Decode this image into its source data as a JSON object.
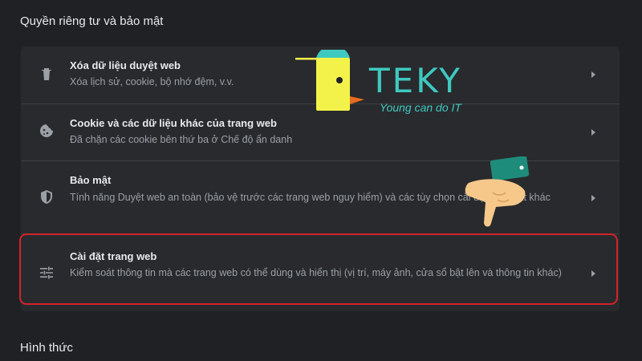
{
  "sections": {
    "privacy_title": "Quyền riêng tư và bảo mật",
    "appearance_title": "Hình thức"
  },
  "rows": [
    {
      "title": "Xóa dữ liệu duyệt web",
      "desc": "Xóa lịch sử, cookie, bộ nhớ đệm, v.v.",
      "icon": "trash-icon"
    },
    {
      "title": "Cookie và các dữ liệu khác của trang web",
      "desc": "Đã chặn các cookie bên thứ ba ở Chế độ ẩn danh",
      "icon": "cookie-icon"
    },
    {
      "title": "Bảo mật",
      "desc": "Tính năng Duyệt web an toàn (bảo vệ trước các trang web nguy hiểm) và các tùy chọn cài đặt bảo mật khác",
      "icon": "shield-icon"
    },
    {
      "title": "Cài đặt trang web",
      "desc": "Kiểm soát thông tin mà các trang web có thể dùng và hiển thị (vị trí, máy ảnh, cửa sổ bật lên và thông tin khác)",
      "icon": "tune-icon"
    }
  ],
  "watermark": {
    "brand": "TEKY",
    "tagline": "Young can do IT"
  },
  "colors": {
    "background": "#202124",
    "card": "#292a2d",
    "highlight": "#d3232a",
    "brand": "#3ec9c0"
  }
}
